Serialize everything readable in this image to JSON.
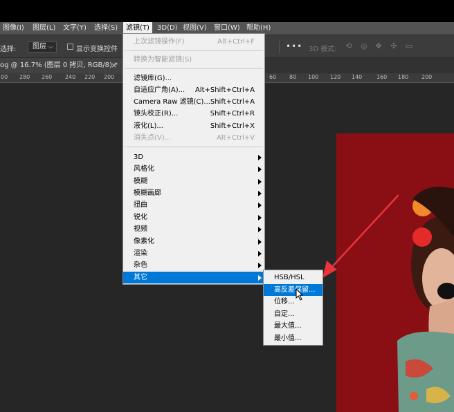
{
  "menubar": {
    "items": [
      {
        "label": "图像(I)"
      },
      {
        "label": "图层(L)"
      },
      {
        "label": "文字(Y)"
      },
      {
        "label": "选择(S)"
      },
      {
        "label": "滤镜(T)"
      },
      {
        "label": "3D(D)"
      },
      {
        "label": "视图(V)"
      },
      {
        "label": "窗口(W)"
      },
      {
        "label": "帮助(H)"
      }
    ]
  },
  "options": {
    "auto_select_label": "选择:",
    "auto_select_value": "图层",
    "show_transform_label": "显示变换控件",
    "mode_3d_label": "3D 模式:"
  },
  "document_tab": {
    "title": "og @ 16.7% (图层 0 拷贝, RGB/8) *",
    "close": "×"
  },
  "ruler": {
    "ticks": [
      "00",
      "280",
      "260",
      "240",
      "220",
      "200",
      "60",
      "80",
      "100",
      "120",
      "140",
      "160",
      "180",
      "200"
    ]
  },
  "filter_menu": {
    "items": [
      {
        "label": "上次滤镜操作(F)",
        "shortcut": "Alt+Ctrl+F",
        "disabled": true
      },
      {
        "label": "转换为智能滤镜(S)",
        "shortcut": "",
        "disabled": true
      },
      {
        "label": "滤镜库(G)...",
        "shortcut": ""
      },
      {
        "label": "自适应广角(A)...",
        "shortcut": "Alt+Shift+Ctrl+A"
      },
      {
        "label": "Camera Raw 滤镜(C)...",
        "shortcut": "Shift+Ctrl+A"
      },
      {
        "label": "镜头校正(R)...",
        "shortcut": "Shift+Ctrl+R"
      },
      {
        "label": "液化(L)...",
        "shortcut": "Shift+Ctrl+X"
      },
      {
        "label": "消失点(V)...",
        "shortcut": "Alt+Ctrl+V",
        "disabled": true
      },
      {
        "label": "3D"
      },
      {
        "label": "风格化"
      },
      {
        "label": "模糊"
      },
      {
        "label": "模糊画廊"
      },
      {
        "label": "扭曲"
      },
      {
        "label": "锐化"
      },
      {
        "label": "视频"
      },
      {
        "label": "像素化"
      },
      {
        "label": "渲染"
      },
      {
        "label": "杂色"
      },
      {
        "label": "其它"
      }
    ]
  },
  "other_submenu": {
    "items": [
      {
        "label": "HSB/HSL"
      },
      {
        "label": "高反差保留..."
      },
      {
        "label": "位移..."
      },
      {
        "label": "自定..."
      },
      {
        "label": "最大值..."
      },
      {
        "label": "最小值..."
      }
    ]
  },
  "colors": {
    "highlight": "#0078d7",
    "menu_bg": "#f0f0f0",
    "annotation_arrow": "#e8343a",
    "photo_bg": "#8a0f14"
  }
}
